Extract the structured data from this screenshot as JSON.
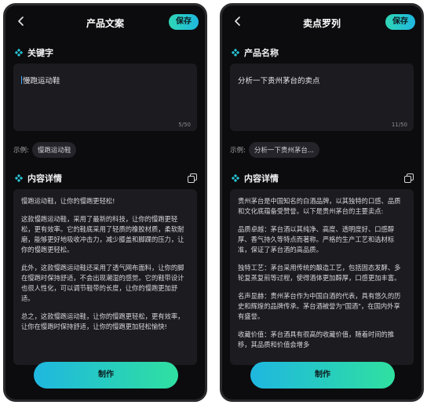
{
  "left": {
    "title": "产品文案",
    "save_label": "保存",
    "keyword_section": "关键字",
    "input_value": "慢跑运动鞋",
    "counter": "5/50",
    "example_label": "示例:",
    "example_chip": "慢跑运动鞋",
    "content_section": "内容详情",
    "paragraphs": [
      "慢跑运动鞋，让你的慢跑更轻松!",
      "这款慢跑运动鞋，采用了最新的科技，让你的慢跑更轻松，更有效率。它的鞋底采用了轻质的橡胶材质，柔软耐磨，能够更好地吸收冲击力，减少膝盖和脚踝的压力，让你的慢跑更轻松。",
      "此外，这款慢跑运动鞋还采用了透气网布面料，让你的脚在慢跑时保持舒适，不会出现潮湿的感觉。它的鞋带设计也很人性化，可以调节鞋带的长度，让你的慢跑更加舒适。",
      "总之，这款慢跑运动鞋，让你的慢跑更轻松，更有效率，让你在慢跑时保持舒适，让你的慢跑更加轻松愉快!"
    ],
    "make_label": "制作"
  },
  "right": {
    "title": "卖点罗列",
    "save_label": "保存",
    "keyword_section": "产品名称",
    "input_value": "分析一下贵州茅台的卖点",
    "counter": "11/50",
    "example_label": "示例:",
    "example_chip": "分析一下贵州茅台...",
    "content_section": "内容详情",
    "paragraphs": [
      "贵州茅台是中国知名的白酒品牌，以其独特的口感、品质和文化底蕴备受赞誉。以下是贵州茅台的主要卖点:",
      "品质卓越：茅台酒以其纯净、高度、透明度好、口感醇厚、香气持久等特点而著称。严格的生产工艺和选材标准，保证了茅台酒的高品质。",
      "独特工艺：茅台采用传统的酿造工艺，包括固态发酵、多轮复蒸复煎等过程，使得酒体更加醇厚，口感更加丰富。",
      "名声显赫：贵州茅台作为中国白酒的代表，具有悠久的历史和辉煌的品牌传承。茅台酒被誉为\"国酒\"，在国内外享有盛誉。",
      "收藏价值：茅台酒具有很高的收藏价值，随着时间的推移，其品质和价值会增多"
    ],
    "make_label": "制作"
  },
  "colors": {
    "accent_start": "#2fd6b5",
    "accent_end": "#1fb7e0",
    "diamond": "#27c4d6",
    "background": "#0c0c0e",
    "panel": "#1c1c20"
  },
  "icons": {
    "back": "chevron-left-icon",
    "section": "diamond-icon",
    "copy": "copy-icon"
  }
}
